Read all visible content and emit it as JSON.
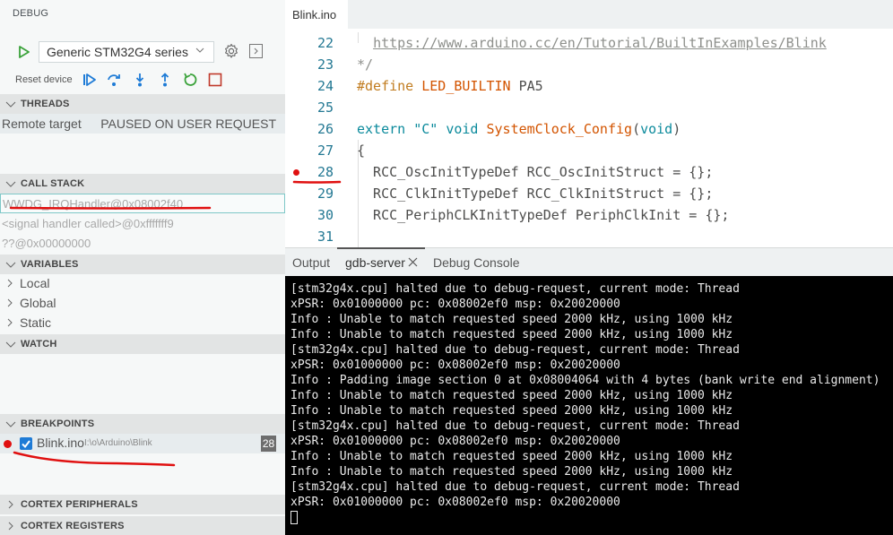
{
  "sidebar": {
    "title": "DEBUG",
    "config": {
      "selected": "Generic STM32G4 series"
    },
    "reset_label": "Reset device",
    "controls": [
      "continue",
      "step-over",
      "step-into",
      "step-out",
      "restart",
      "stop"
    ],
    "threads": {
      "header": "THREADS",
      "rows": [
        {
          "name": "Remote target",
          "state": "PAUSED ON USER REQUEST"
        }
      ]
    },
    "call_stack": {
      "header": "CALL STACK",
      "frames": [
        "WWDG_IRQHandler@0x08002f40",
        "<signal handler called>@0xfffffff9",
        "??@0x00000000"
      ]
    },
    "variables": {
      "header": "VARIABLES",
      "scopes": [
        "Local",
        "Global",
        "Static"
      ]
    },
    "watch": {
      "header": "WATCH"
    },
    "breakpoints": {
      "header": "BREAKPOINTS",
      "items": [
        {
          "file": "Blink.ino",
          "path": "I:\\o\\Arduino\\Blink",
          "line": "28",
          "enabled": true
        }
      ]
    },
    "cortex_peripherals": {
      "header": "CORTEX PERIPHERALS"
    },
    "cortex_registers": {
      "header": "CORTEX REGISTERS"
    }
  },
  "editor": {
    "tab": "Blink.ino",
    "lines": [
      {
        "n": "22",
        "parts": [
          {
            "t": "  "
          },
          {
            "t": "https://www.arduino.cc/en/Tutorial/BuiltInExamples/Blink",
            "c": "c-url"
          }
        ]
      },
      {
        "n": "23",
        "parts": [
          {
            "t": "*/",
            "c": "c-comment"
          }
        ]
      },
      {
        "n": "24",
        "parts": [
          {
            "t": "#define ",
            "c": "c-pre"
          },
          {
            "t": "LED_BUILTIN",
            "c": "c-def"
          },
          {
            "t": " PA5"
          }
        ]
      },
      {
        "n": "25",
        "parts": []
      },
      {
        "n": "26",
        "parts": [
          {
            "t": "extern ",
            "c": "c-kw"
          },
          {
            "t": "\"C\"",
            "c": "c-str"
          },
          {
            "t": " void ",
            "c": "c-kw"
          },
          {
            "t": "SystemClock_Config",
            "c": "c-fn"
          },
          {
            "t": "("
          },
          {
            "t": "void",
            "c": "c-kw"
          },
          {
            "t": ")"
          }
        ]
      },
      {
        "n": "27",
        "parts": [
          {
            "t": "{"
          }
        ]
      },
      {
        "n": "28",
        "bp": true,
        "parts": [
          {
            "t": "  RCC_OscInitTypeDef RCC_OscInitStruct = {};"
          }
        ]
      },
      {
        "n": "29",
        "parts": [
          {
            "t": "  RCC_ClkInitTypeDef RCC_ClkInitStruct = {};"
          }
        ]
      },
      {
        "n": "30",
        "parts": [
          {
            "t": "  RCC_PeriphCLKInitTypeDef PeriphClkInit = {};"
          }
        ]
      },
      {
        "n": "31",
        "parts": []
      }
    ]
  },
  "panel": {
    "tabs": [
      "Output",
      "gdb-server",
      "Debug Console"
    ],
    "active_tab": "gdb-server",
    "terminal_lines": [
      "[stm32g4x.cpu] halted due to debug-request, current mode: Thread",
      "xPSR: 0x01000000 pc: 0x08002ef0 msp: 0x20020000",
      "Info : Unable to match requested speed 2000 kHz, using 1000 kHz",
      "Info : Unable to match requested speed 2000 kHz, using 1000 kHz",
      "[stm32g4x.cpu] halted due to debug-request, current mode: Thread",
      "xPSR: 0x01000000 pc: 0x08002ef0 msp: 0x20020000",
      "Info : Padding image section 0 at 0x08004064 with 4 bytes (bank write end alignment)",
      "Info : Unable to match requested speed 2000 kHz, using 1000 kHz",
      "Info : Unable to match requested speed 2000 kHz, using 1000 kHz",
      "[stm32g4x.cpu] halted due to debug-request, current mode: Thread",
      "xPSR: 0x01000000 pc: 0x08002ef0 msp: 0x20020000",
      "Info : Unable to match requested speed 2000 kHz, using 1000 kHz",
      "Info : Unable to match requested speed 2000 kHz, using 1000 kHz",
      "[stm32g4x.cpu] halted due to debug-request, current mode: Thread",
      "xPSR: 0x01000000 pc: 0x08002ef0 msp: 0x20020000"
    ]
  },
  "colors": {
    "breakpoint": "#e01010",
    "annotation": "#e01010",
    "accent_blue": "#1e7bd6",
    "restart_green": "#3aa23a",
    "stop_red": "#c0392b"
  }
}
